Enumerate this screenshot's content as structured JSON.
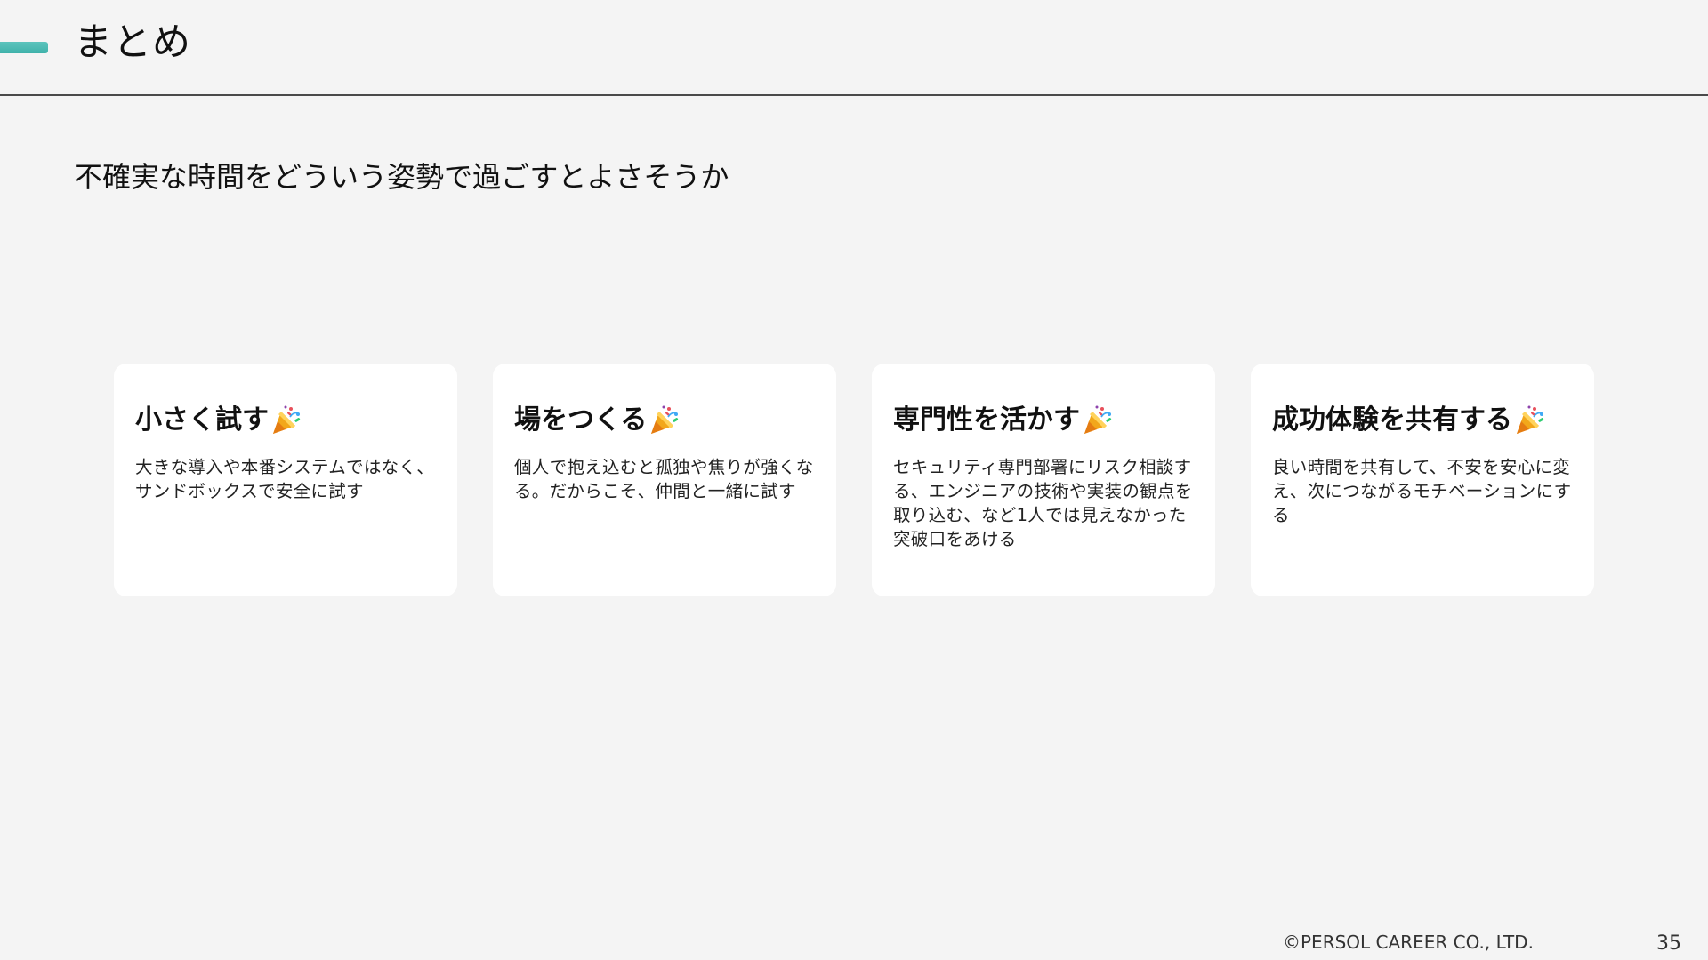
{
  "header": {
    "title": "まとめ"
  },
  "subtitle": "不確実な時間をどういう姿勢で過ごすとよさそうか",
  "cards": [
    {
      "title": "小さく試す",
      "icon": "party-popper-icon",
      "body": "大きな導入や本番システムではなく、サンドボックスで安全に試す"
    },
    {
      "title": "場をつくる",
      "icon": "party-popper-icon",
      "body": "個人で抱え込むと孤独や焦りが強くなる。だからこそ、仲間と一緒に試す"
    },
    {
      "title": "専門性を活かす",
      "icon": "party-popper-icon",
      "body": "セキュリティ専門部署にリスク相談する、エンジニアの技術や実装の観点を取り込む、など1人では見えなかった突破口をあける"
    },
    {
      "title": "成功体験を共有する",
      "icon": "party-popper-icon",
      "body": "良い時間を共有して、不安を安心に変え、次につながるモチベーションにする"
    }
  ],
  "footer": {
    "copyright": "©PERSOL CAREER CO., LTD.",
    "page_number": "35"
  },
  "colors": {
    "accent": "#3fb2aa",
    "background": "#f4f4f4",
    "card": "#ffffff",
    "rule": "#4a4a4a"
  }
}
